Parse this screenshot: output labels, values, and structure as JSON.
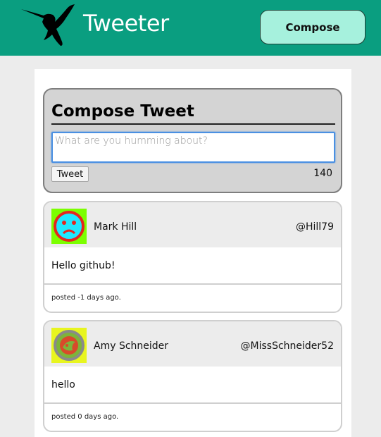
{
  "header": {
    "logo_icon": "hummingbird-logo-icon",
    "title": "Tweeter",
    "compose_label": "Compose",
    "colors": {
      "bar": "#0a9e80",
      "compose_button": "#a6f1dd"
    }
  },
  "compose": {
    "title": "Compose Tweet",
    "placeholder": "What are you humming about?",
    "value": "",
    "submit_label": "Tweet",
    "char_count": "140"
  },
  "tweets": [
    {
      "name": "Mark Hill",
      "handle": "@Hill79",
      "text": "Hello github!",
      "posted": "posted -1 days ago.",
      "avatar_icon": "sad-face-avatar-icon",
      "avatar_colors": {
        "background": "#7cff00",
        "ring": "#e4261e",
        "face": "#1fe8ff"
      }
    },
    {
      "name": "Amy Schneider",
      "handle": "@MissSchneider52",
      "text": "hello",
      "posted": "posted 0 days ago.",
      "avatar_icon": "leaf-pattern-avatar-icon",
      "avatar_colors": {
        "background": "#e8f51f",
        "ring": "#8a8a8a",
        "face": "#7db43a"
      }
    }
  ]
}
